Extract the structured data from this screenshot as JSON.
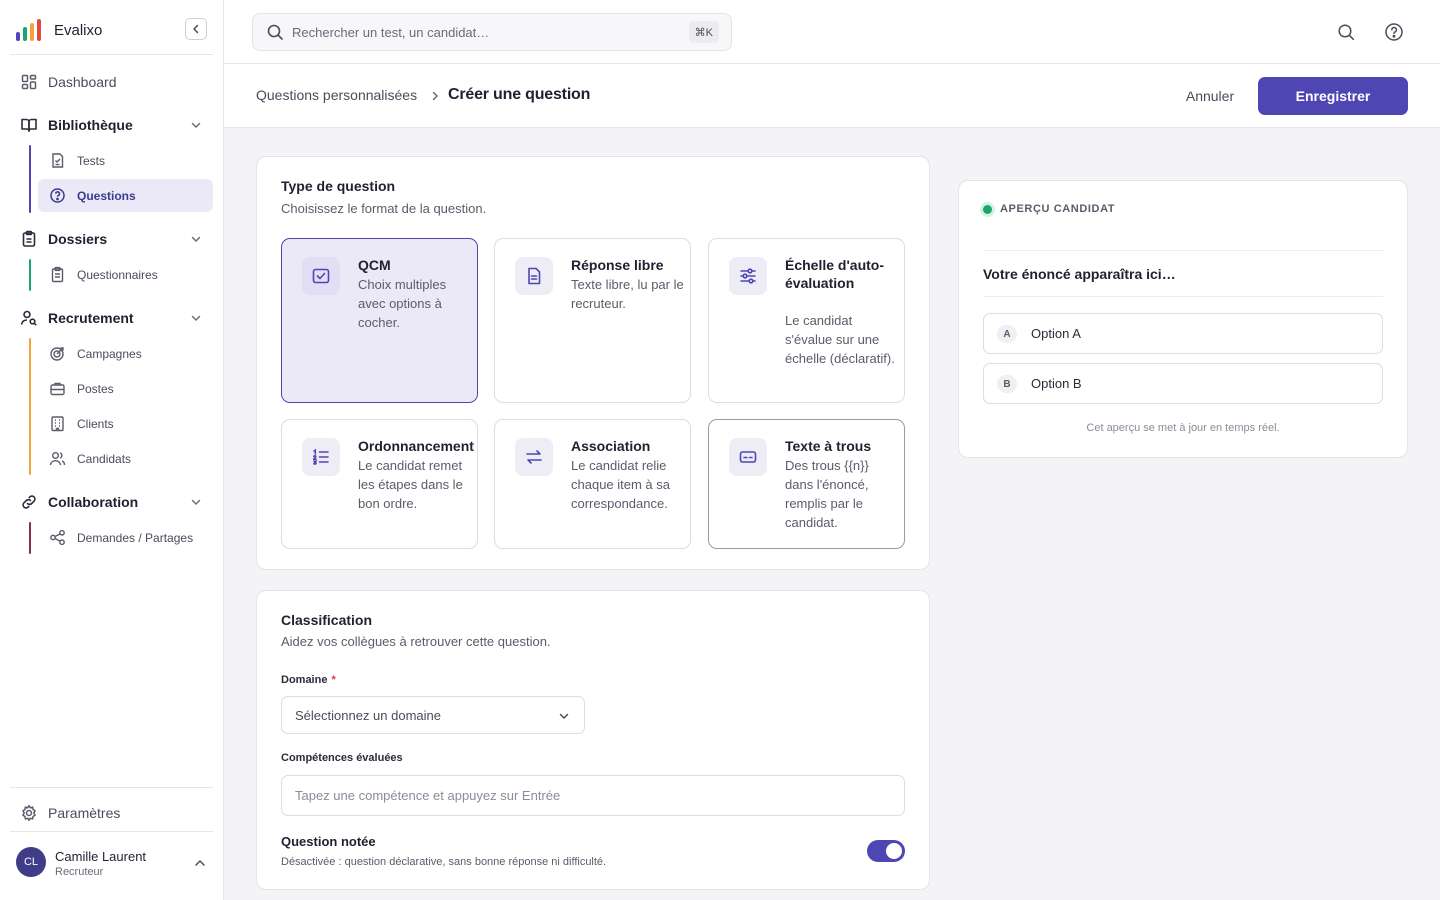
{
  "app": {
    "name": "Evalixo"
  },
  "colors": {
    "accent": "#4e46b3",
    "accent_soft": "#ebe9f7",
    "preview_dot": "#1ea56c"
  },
  "sidebar": {
    "dashboard": "Dashboard",
    "groups": [
      {
        "label": "Bibliothèque",
        "items": [
          "Tests",
          "Questions"
        ]
      },
      {
        "label": "Dossiers",
        "items": [
          "Questionnaires"
        ]
      },
      {
        "label": "Recrutement",
        "items": [
          "Campagnes",
          "Postes",
          "Clients",
          "Candidats"
        ]
      },
      {
        "label": "Collaboration",
        "items": [
          "Demandes / Partages"
        ]
      }
    ],
    "active_item": "Questions",
    "settings": "Paramètres",
    "user": {
      "initials": "CL",
      "name": "Camille Laurent",
      "role": "Recruteur"
    }
  },
  "topbar": {
    "search_placeholder": "Rechercher un test, un candidat…",
    "shortcut": "⌘K"
  },
  "header": {
    "breadcrumb_parent": "Questions personnalisées",
    "title": "Créer une question",
    "cancel_label": "Annuler",
    "save_label": "Enregistrer"
  },
  "type_section": {
    "title": "Type de question",
    "subtitle": "Choisissez le format de la question.",
    "selected": "QCM",
    "types": [
      {
        "title": "QCM",
        "desc": "Choix multiples avec options à cocher.",
        "icon": "checkbox-icon"
      },
      {
        "title": "Réponse libre",
        "desc": "Texte libre, lu par le recruteur.",
        "icon": "document-icon"
      },
      {
        "title": "Échelle d'auto-évaluation",
        "desc": "Le candidat s'évalue sur une échelle (déclaratif).",
        "icon": "sliders-icon"
      },
      {
        "title": "Ordonnancement",
        "desc": "Le candidat remet les étapes dans le bon ordre.",
        "icon": "ordered-list-icon"
      },
      {
        "title": "Association",
        "desc": "Le candidat relie chaque item à sa correspondance.",
        "icon": "arrows-exchange-icon"
      },
      {
        "title": "Texte à trous",
        "desc": "Des trous {{n}} dans l'énoncé, remplis par le candidat.",
        "icon": "input-blank-icon"
      }
    ]
  },
  "classification": {
    "title": "Classification",
    "subtitle": "Aidez vos collègues à retrouver cette question.",
    "domain_label": "Domaine",
    "domain_required": "*",
    "domain_value": "Sélectionnez un domaine",
    "skills_label": "Compétences évaluées",
    "skills_placeholder": "Tapez une compétence et appuyez sur Entrée",
    "graded_label": "Question notée",
    "graded_desc": "Désactivée : question déclarative, sans bonne réponse ni difficulté."
  },
  "preview": {
    "heading": "APERÇU CANDIDAT",
    "statement": "Votre énoncé apparaîtra ici…",
    "options": [
      {
        "letter": "A",
        "text": "Option A"
      },
      {
        "letter": "B",
        "text": "Option B"
      }
    ],
    "note": "Cet aperçu se met à jour en temps réel."
  }
}
